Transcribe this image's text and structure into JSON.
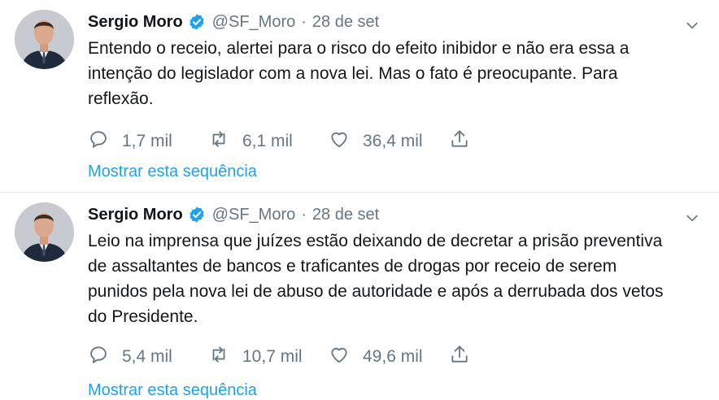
{
  "tweets": [
    {
      "name": "Sergio Moro",
      "handle": "@SF_Moro",
      "separator": "·",
      "date": "28 de set",
      "text_lines": [
        "Entendo o receio, alertei para o risco do efeito inibidor e não era essa a",
        "intenção do legislador com a nova lei. Mas o fato é preocupante. Para",
        "reflexão."
      ],
      "replies": "1,7 mil",
      "retweets": "6,1 mil",
      "likes": "36,4 mil",
      "show_thread": "Mostrar esta sequência"
    },
    {
      "name": "Sergio Moro",
      "handle": "@SF_Moro",
      "separator": "·",
      "date": "28 de set",
      "text_lines": [
        "Leio na imprensa que juízes estão deixando de decretar a prisão preventiva",
        "de assaltantes de bancos e traficantes de drogas por receio de serem",
        "punidos pela nova lei de abuso de autoridade e após a derrubada dos vetos",
        "do Presidente."
      ],
      "replies": "5,4 mil",
      "retweets": "10,7 mil",
      "likes": "49,6 mil",
      "show_thread": "Mostrar esta sequência"
    }
  ],
  "icons": {
    "verified": "verified-badge-icon",
    "caret": "chevron-down-icon",
    "reply": "reply-icon",
    "retweet": "retweet-icon",
    "like": "heart-icon",
    "share": "share-icon"
  },
  "colors": {
    "accent": "#1da1f2",
    "muted": "#657786",
    "divider": "#e1e8ed"
  }
}
